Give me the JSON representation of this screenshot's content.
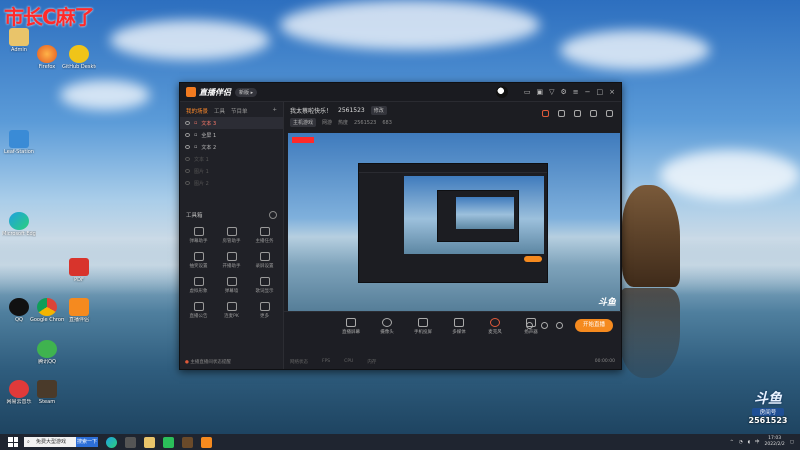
{
  "overlay": {
    "watermark": "市长C麻了"
  },
  "desktop": {
    "icons": [
      {
        "label": "Admin"
      },
      {
        "label": "Firefox"
      },
      {
        "label": "GitHub Desktop"
      },
      {
        "label": "Leaf-Station"
      },
      {
        "label": "Microsoft Edge"
      },
      {
        "label": "QQ"
      },
      {
        "label": "网易云音乐"
      },
      {
        "label": "Google Chrome"
      },
      {
        "label": "PDF"
      },
      {
        "label": "直播伴侣"
      },
      {
        "label": "腾讯QQ"
      },
      {
        "label": "Steam"
      }
    ]
  },
  "app": {
    "name": "直播伴侣",
    "version": "新版 ▸",
    "tabs": [
      "我的场景",
      "工具",
      "节目单"
    ],
    "scenes": [
      {
        "label": "文本 3"
      },
      {
        "label": "全屏 1"
      },
      {
        "label": "文本 2"
      },
      {
        "label": "文本 1"
      },
      {
        "label": "图片 1"
      },
      {
        "label": "图片 2"
      }
    ],
    "tools_title": "工具箱",
    "tools": [
      {
        "label": "弹幕助手"
      },
      {
        "label": "房管助手"
      },
      {
        "label": "主播任务"
      },
      {
        "label": "抽奖设置"
      },
      {
        "label": "开播助手"
      },
      {
        "label": "录屏设置"
      },
      {
        "label": "虚拟形象"
      },
      {
        "label": "弹幕墙"
      },
      {
        "label": "歌词显示"
      },
      {
        "label": "直播公告"
      },
      {
        "label": "连麦PK"
      },
      {
        "label": "更多"
      }
    ],
    "notice": "主播直播间状态提醒",
    "room": {
      "title": "我太蔡啦快乐！",
      "id": "2561523",
      "edit_label": "修改",
      "category_tag": "主机游戏",
      "category": "网游",
      "viewers_label": "热度",
      "viewers": "2561523",
      "fans": "683"
    },
    "controls": [
      {
        "label": "直播屏幕"
      },
      {
        "label": "摄像头"
      },
      {
        "label": "手机投屏"
      },
      {
        "label": "多媒体"
      },
      {
        "label": "麦克风"
      },
      {
        "label": "扬声器"
      }
    ],
    "live_button": "开始直播",
    "status": {
      "net": "网络状态",
      "fps": "FPS",
      "cpu": "CPU",
      "mem": "内存",
      "time": "00:00:00"
    }
  },
  "taskbar": {
    "search_text": "免费大型游戏",
    "search_button": "搜索一下",
    "time": "17:03",
    "date": "2022/2/2"
  },
  "douyu": {
    "logo": "斗鱼",
    "room_label": "房间号",
    "room_number": "2561523"
  }
}
